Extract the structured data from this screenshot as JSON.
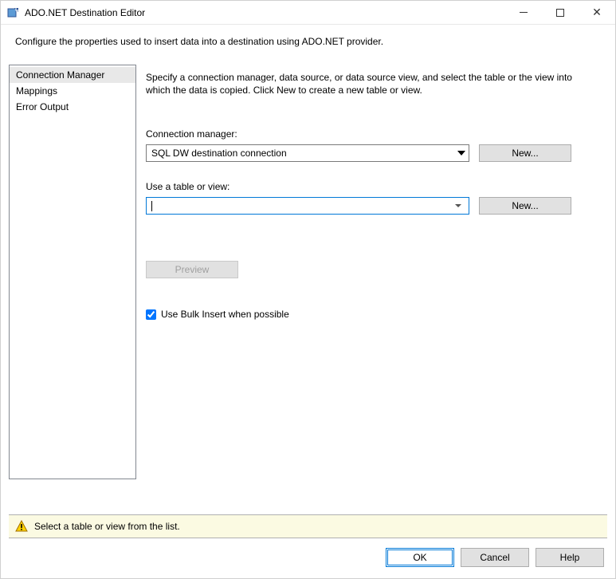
{
  "window": {
    "title": "ADO.NET Destination Editor"
  },
  "description": "Configure the properties used to insert data into a destination using ADO.NET provider.",
  "sidebar": {
    "items": [
      {
        "label": "Connection Manager",
        "selected": true
      },
      {
        "label": "Mappings",
        "selected": false
      },
      {
        "label": "Error Output",
        "selected": false
      }
    ]
  },
  "content": {
    "intro": "Specify a connection manager, data source, or data source view, and select the table or the view into which the data is copied. Click New to create a new table or view.",
    "connection_label": "Connection manager:",
    "connection_value": "SQL DW destination connection",
    "connection_new": "New...",
    "table_label": "Use a table or view:",
    "table_value": "",
    "table_new": "New...",
    "preview_label": "Preview",
    "bulk_insert_label": "Use Bulk Insert when possible",
    "bulk_insert_checked": true
  },
  "status": {
    "message": "Select a table or view from the list."
  },
  "footer": {
    "ok": "OK",
    "cancel": "Cancel",
    "help": "Help"
  }
}
